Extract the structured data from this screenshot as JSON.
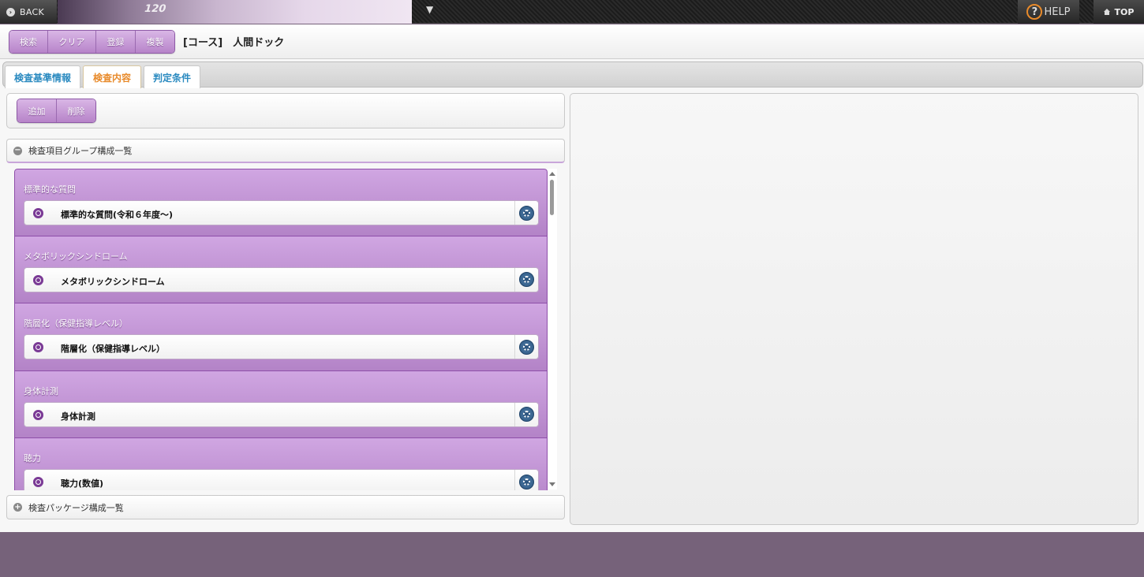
{
  "topbar": {
    "back_label": "BACK",
    "banner_text": "120",
    "dropdown_glyph": "▼",
    "help_label": "HELP",
    "top_label": "TOP"
  },
  "toolbar": {
    "buttons": [
      {
        "label": "検索"
      },
      {
        "label": "クリア"
      },
      {
        "label": "登録"
      },
      {
        "label": "複製"
      }
    ],
    "course_title": "[コース]　人間ドック"
  },
  "tabs": [
    {
      "label": "検査基準情報",
      "active": false
    },
    {
      "label": "検査内容",
      "active": true
    },
    {
      "label": "判定条件",
      "active": false
    }
  ],
  "actions": {
    "add_label": "追加",
    "delete_label": "削除"
  },
  "group_section": {
    "collapse_glyph": "−",
    "title": "検査項目グループ構成一覧"
  },
  "groups": [
    {
      "title": "標準的な質問",
      "item": "標準的な質問(令和６年度～)"
    },
    {
      "title": "メタボリックシンドローム",
      "item": "メタボリックシンドローム"
    },
    {
      "title": "階層化（保健指導レベル）",
      "item": "階層化（保健指導レベル）"
    },
    {
      "title": "身体計測",
      "item": "身体計測"
    },
    {
      "title": "聴力",
      "item": "聴力(数値)"
    }
  ],
  "package_section": {
    "expand_glyph": "+",
    "title": "検査パッケージ構成一覧"
  },
  "colors": {
    "accent_purple": "#b784c9",
    "active_tab": "#e88a2a",
    "tab_text": "#2a8ac0",
    "background": "#76627a"
  }
}
